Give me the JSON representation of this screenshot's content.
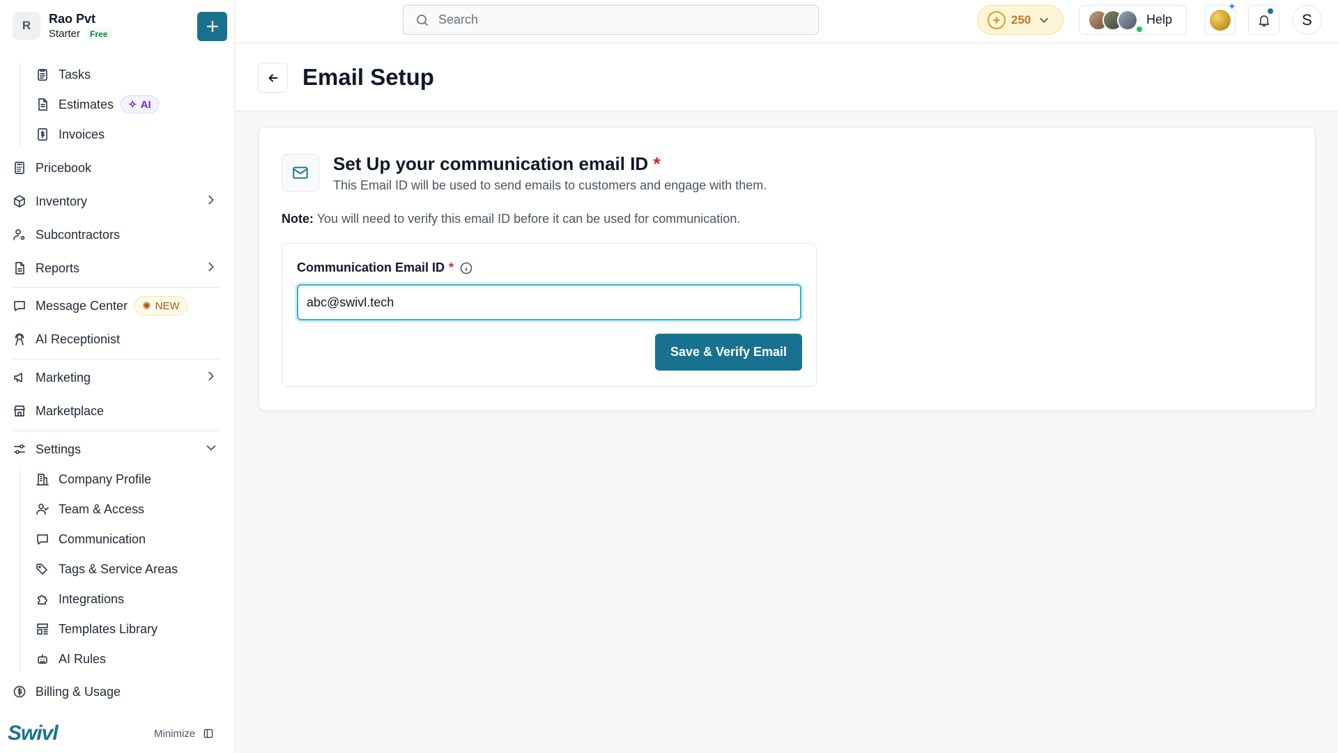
{
  "workspace": {
    "avatar_letter": "R",
    "name": "Rao Pvt",
    "plan": "Starter",
    "plan_badge": "Free"
  },
  "sidebar": {
    "sub_items_top": [
      {
        "label": "Tasks",
        "icon": "clipboard-icon"
      },
      {
        "label": "Estimates",
        "icon": "document-icon",
        "badge": "AI"
      },
      {
        "label": "Invoices",
        "icon": "dollar-document-icon"
      }
    ],
    "items": [
      {
        "label": "Pricebook",
        "icon": "calculator-icon"
      },
      {
        "label": "Inventory",
        "icon": "box-icon",
        "chevron": "right"
      },
      {
        "label": "Subcontractors",
        "icon": "user-gear-icon"
      },
      {
        "label": "Reports",
        "icon": "report-icon",
        "chevron": "right"
      },
      {
        "label": "Message Center",
        "icon": "chat-icon",
        "badge": "NEW"
      },
      {
        "label": "AI Receptionist",
        "icon": "receptionist-icon"
      },
      {
        "label": "Marketing",
        "icon": "megaphone-icon",
        "chevron": "right"
      },
      {
        "label": "Marketplace",
        "icon": "store-icon"
      },
      {
        "label": "Settings",
        "icon": "sliders-icon",
        "chevron": "down"
      }
    ],
    "settings_items": [
      {
        "label": "Company Profile",
        "icon": "building-icon"
      },
      {
        "label": "Team & Access",
        "icon": "users-icon"
      },
      {
        "label": "Communication",
        "icon": "message-icon"
      },
      {
        "label": "Tags & Service Areas",
        "icon": "tag-icon"
      },
      {
        "label": "Integrations",
        "icon": "puzzle-icon"
      },
      {
        "label": "Templates Library",
        "icon": "template-icon"
      },
      {
        "label": "AI Rules",
        "icon": "robot-icon"
      }
    ],
    "billing": {
      "label": "Billing & Usage",
      "icon": "coin-icon"
    },
    "logo_text": "Swivl",
    "minimize_label": "Minimize"
  },
  "topbar": {
    "search_placeholder": "Search",
    "coins": "250",
    "help_label": "Help",
    "user_initial": "S"
  },
  "page": {
    "title": "Email Setup"
  },
  "card": {
    "title": "Set Up your communication email ID",
    "required_mark": "*",
    "subtitle": "This Email ID will be used to send emails to customers and engage with them.",
    "note_label": "Note:",
    "note_text": "You will need to verify this email ID before it can be used for communication.",
    "field_label": "Communication Email ID",
    "field_value": "abc@swivl.tech",
    "submit_label": "Save & Verify Email"
  },
  "colors": {
    "accent": "#18728f",
    "focus_ring": "#38b2c9",
    "required": "#dc2626"
  }
}
